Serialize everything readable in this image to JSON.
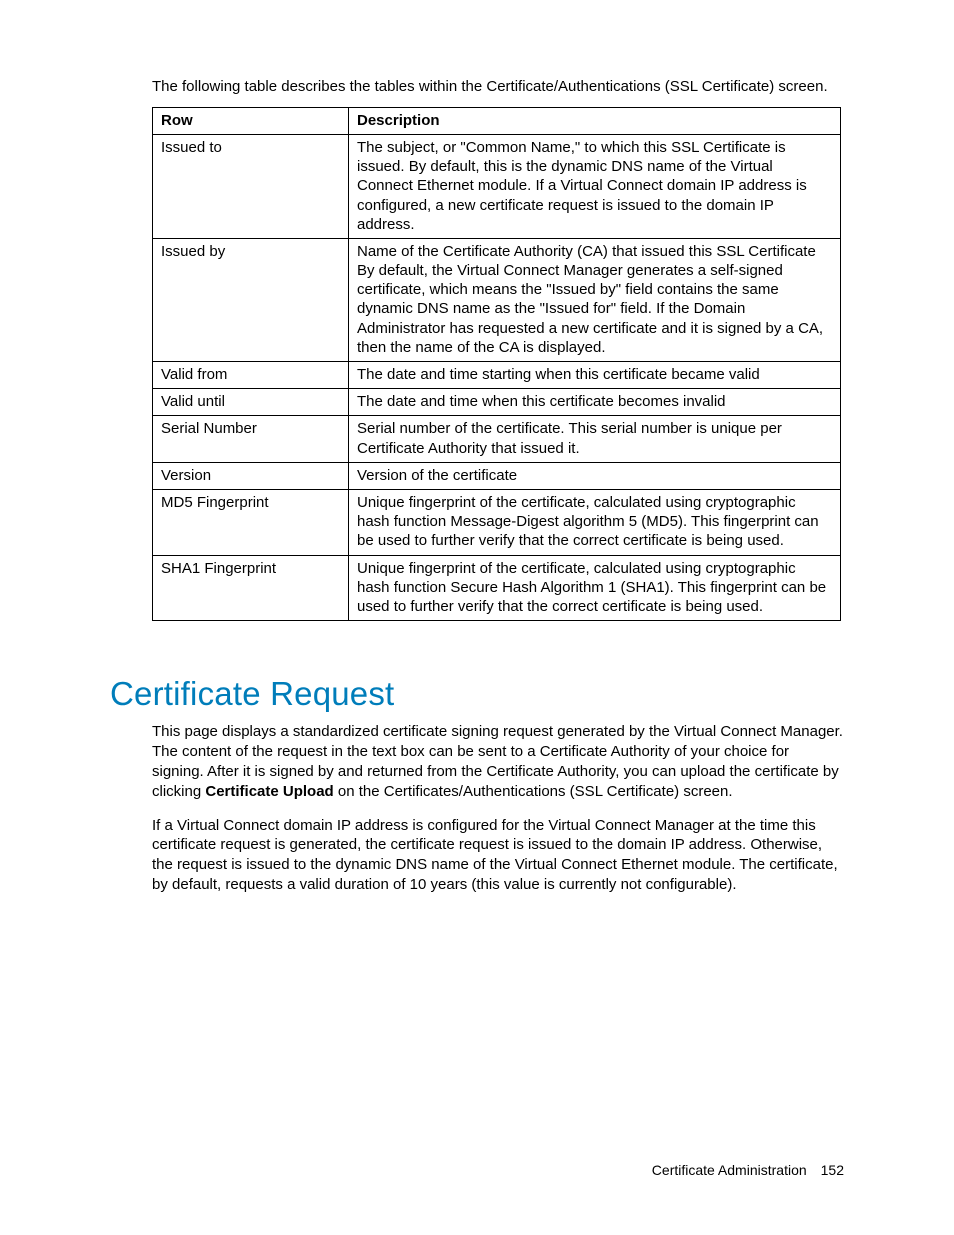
{
  "intro": "The following table describes the tables within the Certificate/Authentications (SSL Certificate) screen.",
  "table": {
    "headers": {
      "row": "Row",
      "desc": "Description"
    },
    "rows": [
      {
        "row": "Issued to",
        "desc": "The subject, or \"Common Name,\" to which this SSL Certificate is issued. By default, this is the dynamic DNS name of the Virtual Connect Ethernet module. If a Virtual Connect domain IP address is configured, a new certificate request is issued to the domain IP address."
      },
      {
        "row": "Issued by",
        "desc": "Name of the Certificate Authority (CA) that issued this SSL Certificate\nBy default, the Virtual Connect Manager generates a self-signed certificate, which means the \"Issued by\" field contains the same dynamic DNS name as the \"Issued for\" field. If the Domain Administrator has requested a new certificate and it is signed by a CA, then the name of the CA is displayed."
      },
      {
        "row": "Valid from",
        "desc": "The date and time starting when this certificate became valid"
      },
      {
        "row": "Valid until",
        "desc": "The date and time when this certificate becomes invalid"
      },
      {
        "row": "Serial Number",
        "desc": "Serial number of the certificate. This serial number is unique per Certificate Authority that issued it."
      },
      {
        "row": "Version",
        "desc": "Version of the certificate"
      },
      {
        "row": "MD5 Fingerprint",
        "desc": "Unique fingerprint of the certificate, calculated using cryptographic hash function Message-Digest algorithm 5 (MD5). This fingerprint can be used to further verify that the correct certificate is being used."
      },
      {
        "row": "SHA1 Fingerprint",
        "desc": "Unique fingerprint of the certificate, calculated using cryptographic hash function Secure Hash Algorithm 1 (SHA1). This fingerprint can be used to further verify that the correct certificate is being used."
      }
    ]
  },
  "section": {
    "heading": "Certificate Request",
    "para1_pre": "This page displays a standardized certificate signing request generated by the Virtual Connect Manager. The content of the request in the text box can be sent to a Certificate Authority of your choice for signing. After it is signed by and returned from the Certificate Authority, you can upload the certificate by clicking ",
    "para1_bold": "Certificate Upload",
    "para1_post": " on the Certificates/Authentications (SSL Certificate) screen.",
    "para2": "If a Virtual Connect domain IP address is configured for the Virtual Connect Manager at the time this certificate request is generated, the certificate request is issued to the domain IP address. Otherwise, the request is issued to the dynamic DNS name of the Virtual Connect Ethernet module. The certificate, by default, requests a valid duration of 10 years (this value is currently not configurable)."
  },
  "footer": {
    "section": "Certificate Administration",
    "page": "152"
  }
}
